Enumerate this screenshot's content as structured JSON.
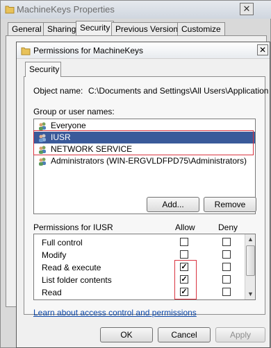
{
  "bg_window": {
    "title": "MachineKeys Properties",
    "close": "✕",
    "tabs": [
      "General",
      "Sharing",
      "Security",
      "Previous Versions",
      "Customize"
    ]
  },
  "dialog": {
    "title": "Permissions for MachineKeys",
    "close": "✕",
    "tab": "Security",
    "object_name_label": "Object name:",
    "object_name_value": "C:\\Documents and Settings\\All Users\\Application D",
    "group_label": "Group or user names:",
    "users": [
      {
        "name": "Everyone",
        "selected": false
      },
      {
        "name": "IUSR",
        "selected": true
      },
      {
        "name": "NETWORK SERVICE",
        "selected": false
      },
      {
        "name": "Administrators (WIN-ERGVLDFPD75\\Administrators)",
        "selected": false
      }
    ],
    "add_button": "Add...",
    "remove_button": "Remove",
    "permissions_for": "Permissions for IUSR",
    "allow_header": "Allow",
    "deny_header": "Deny",
    "permissions": [
      {
        "name": "Full control",
        "allow": false,
        "deny": false
      },
      {
        "name": "Modify",
        "allow": false,
        "deny": false
      },
      {
        "name": "Read & execute",
        "allow": true,
        "deny": false
      },
      {
        "name": "List folder contents",
        "allow": true,
        "deny": false
      },
      {
        "name": "Read",
        "allow": true,
        "deny": false
      }
    ],
    "link": "Learn about access control and permissions",
    "ok_button": "OK",
    "cancel_button": "Cancel",
    "apply_button": "Apply"
  }
}
